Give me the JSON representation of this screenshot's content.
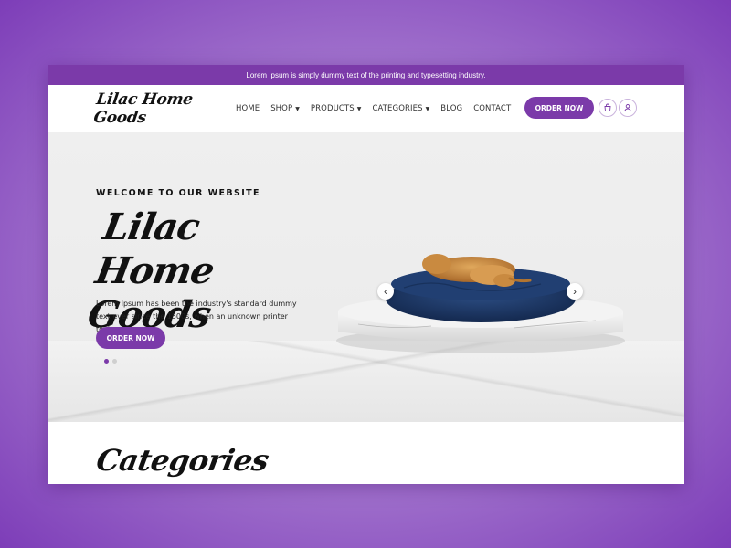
{
  "topbar": {
    "text": "Lorem Ipsum is simply dummy text of the printing and typesetting industry."
  },
  "header": {
    "logo": "Lilac Home Goods",
    "nav": [
      {
        "label": "HOME",
        "has_caret": false
      },
      {
        "label": "SHOP",
        "has_caret": true
      },
      {
        "label": "PRODUCTS",
        "has_caret": true
      },
      {
        "label": "CATEGORIES",
        "has_caret": true
      },
      {
        "label": "BLOG",
        "has_caret": false
      },
      {
        "label": "CONTACT",
        "has_caret": false
      }
    ],
    "caret_glyph": "▼",
    "order_button": "ORDER NOW",
    "icons": [
      "shopping-bag-icon",
      "user-icon"
    ]
  },
  "hero": {
    "welcome": "WELCOME TO OUR WEBSITE",
    "title": "Lilac Home Goods",
    "description": "Lorem Ipsum has been the industry's standard dummy text ever since the 1500s, when an unknown printer took...",
    "button": "ORDER NOW",
    "slides": {
      "count": 2,
      "active": 1
    },
    "arrows": {
      "prev": "‹",
      "next": "›"
    }
  },
  "section": {
    "title": "Categories"
  },
  "colors": {
    "accent": "#7b3aa9",
    "background_outer": "#8a4cc2"
  }
}
